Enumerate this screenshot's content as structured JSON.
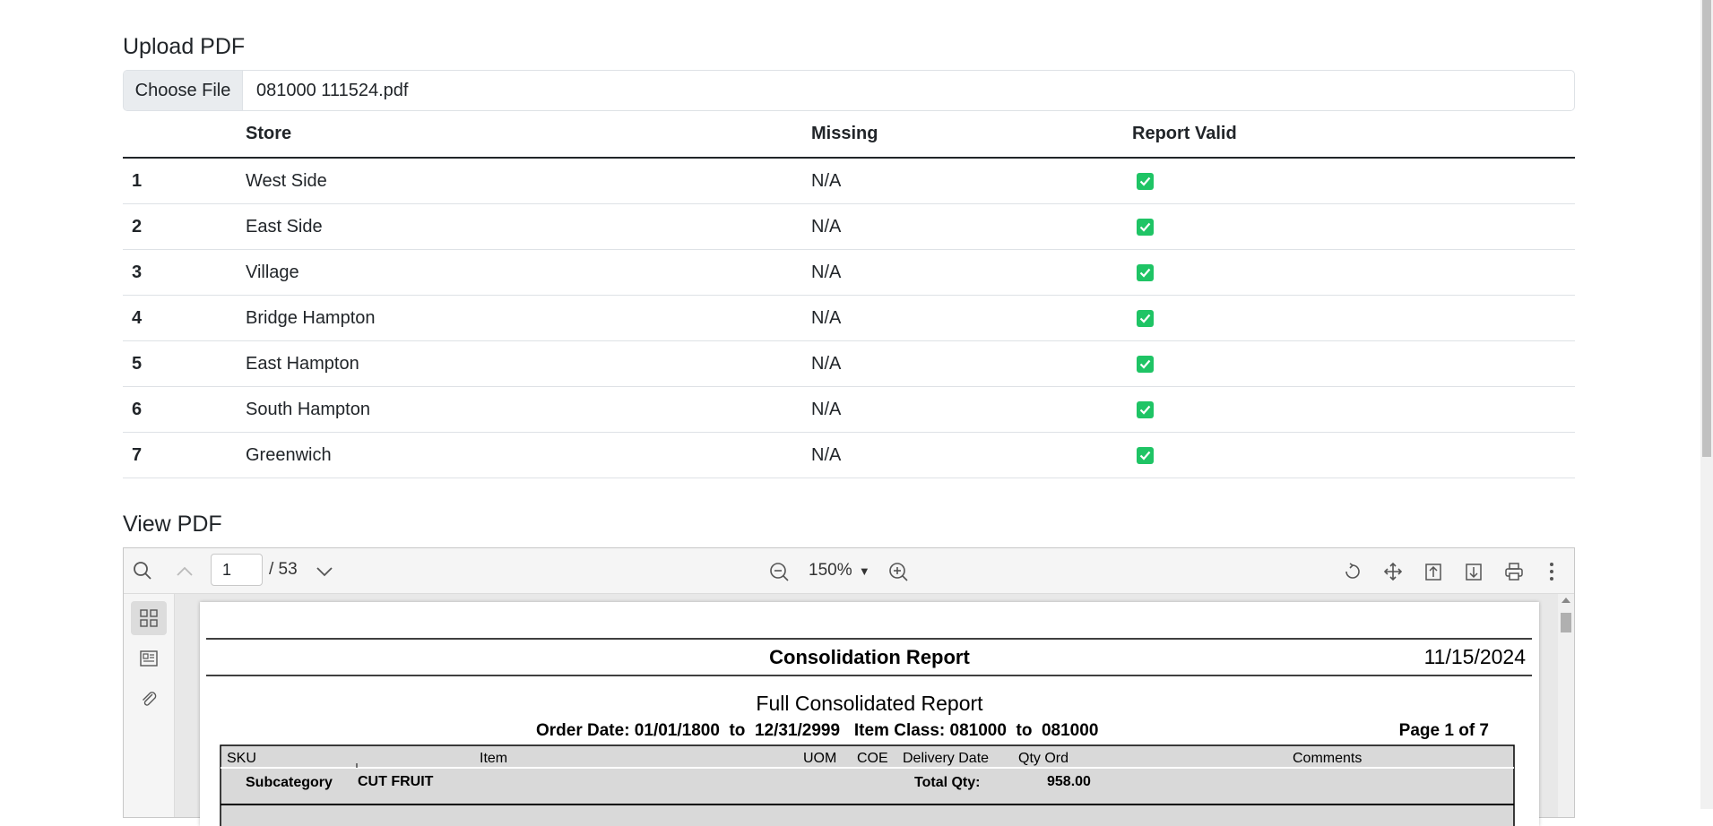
{
  "upload": {
    "title": "Upload PDF",
    "choose_label": "Choose File",
    "file_name": "081000 111524.pdf"
  },
  "table": {
    "headers": [
      "",
      "Store",
      "Missing",
      "Report Valid"
    ],
    "rows": [
      {
        "idx": "1",
        "store": "West Side",
        "missing": "N/A",
        "valid": true
      },
      {
        "idx": "2",
        "store": "East Side",
        "missing": "N/A",
        "valid": true
      },
      {
        "idx": "3",
        "store": "Village",
        "missing": "N/A",
        "valid": true
      },
      {
        "idx": "4",
        "store": "Bridge Hampton",
        "missing": "N/A",
        "valid": true
      },
      {
        "idx": "5",
        "store": "East Hampton",
        "missing": "N/A",
        "valid": true
      },
      {
        "idx": "6",
        "store": "South Hampton",
        "missing": "N/A",
        "valid": true
      },
      {
        "idx": "7",
        "store": "Greenwich",
        "missing": "N/A",
        "valid": true
      }
    ]
  },
  "viewer": {
    "title": "View PDF",
    "page_input": "1",
    "page_total": "/ 53",
    "zoom": "150%",
    "colors": {
      "check": "#1fc465"
    }
  },
  "report": {
    "title": "Consolidation Report",
    "date": "11/15/2024",
    "subtitle": "Full Consolidated Report",
    "criteria": "Order Date: 01/01/1800  to  12/31/2999   Item Class: 081000  to  081000",
    "page": "Page 1 of 7",
    "columns": [
      "SKU",
      "Item",
      "UOM",
      "COE",
      "Delivery Date",
      "Qty Ord",
      "Comments"
    ],
    "subcategory_label": "Subcategory",
    "subcategory_value": "CUT FRUIT",
    "total_label": "Total Qty:",
    "total_value": "958.00"
  }
}
